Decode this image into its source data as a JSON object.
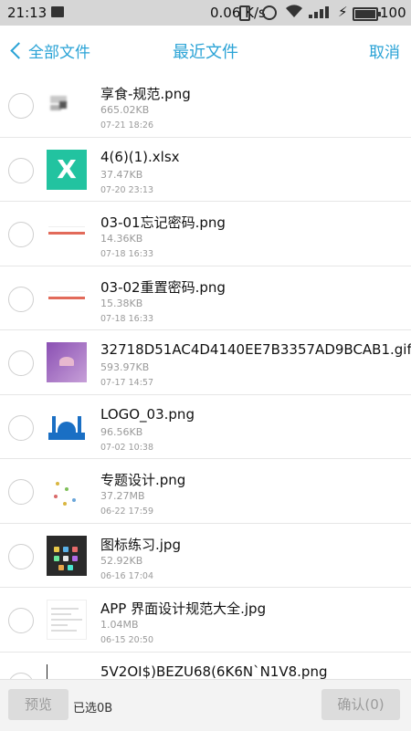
{
  "statusbar": {
    "time": "21:13",
    "speed": "0.06 K/s",
    "battery": "100",
    "icons": [
      "message-icon",
      "vibrate-icon",
      "alarm-icon",
      "wifi-icon",
      "signal-icon",
      "charging-icon",
      "battery-icon"
    ]
  },
  "header": {
    "back_label": "全部文件",
    "title": "最近文件",
    "cancel_label": "取消",
    "accent": "#2aa3d6"
  },
  "files": [
    {
      "name": "享食-规范.png",
      "size": "665.02KB",
      "date": "07-21 18:26",
      "thumb": "blur-image"
    },
    {
      "name": "4(6)(1).xlsx",
      "size": "37.47KB",
      "date": "07-20 23:13",
      "thumb": "excel-icon"
    },
    {
      "name": "03-01忘记密码.png",
      "size": "14.36KB",
      "date": "07-18 16:33",
      "thumb": "red-bar-image"
    },
    {
      "name": "03-02重置密码.png",
      "size": "15.38KB",
      "date": "07-18 16:33",
      "thumb": "red-bar-image"
    },
    {
      "name": "32718D51AC4D4140EE7B3357AD9BCAB1.gif",
      "size": "593.97KB",
      "date": "07-17 14:57",
      "thumb": "purple-gif-image"
    },
    {
      "name": "LOGO_03.png",
      "size": "96.56KB",
      "date": "07-02 10:38",
      "thumb": "mosque-logo-image"
    },
    {
      "name": "专题设计.png",
      "size": "37.27MB",
      "date": "06-22 17:59",
      "thumb": "scatter-image"
    },
    {
      "name": "图标练习.jpg",
      "size": "52.92KB",
      "date": "06-16 17:04",
      "thumb": "icon-grid-image"
    },
    {
      "name": "APP 界面设计规范大全.jpg",
      "size": "1.04MB",
      "date": "06-15 20:50",
      "thumb": "document-image"
    },
    {
      "name": "5V2OI$)BEZU68(6K6N`N1V8.png",
      "size": "",
      "date": "",
      "thumb": "purple-wave-image"
    }
  ],
  "footer": {
    "preview_label": "预览",
    "selected_label": "已选0B",
    "confirm_label": "确认(0)"
  }
}
